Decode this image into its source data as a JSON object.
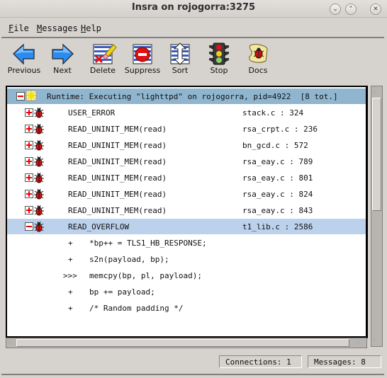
{
  "window": {
    "title": "Insra on rojogorra:3275",
    "controls": [
      "minimize",
      "maximize",
      "close"
    ]
  },
  "menubar": {
    "items": [
      {
        "label": "File",
        "mnemonic": "F",
        "rest": "ile"
      },
      {
        "label": "Messages",
        "mnemonic": "M",
        "rest": "essages"
      },
      {
        "label": "Help",
        "mnemonic": "H",
        "rest": "elp"
      }
    ]
  },
  "toolbar": {
    "buttons": [
      {
        "label": "Previous",
        "icon": "arrow-left-icon"
      },
      {
        "label": "Next",
        "icon": "arrow-right-icon"
      },
      {
        "label": "Delete",
        "icon": "delete-eraser-icon"
      },
      {
        "label": "Suppress",
        "icon": "suppress-icon"
      },
      {
        "label": "Sort",
        "icon": "sort-icon"
      },
      {
        "label": "Stop",
        "icon": "traffic-light-icon"
      },
      {
        "label": "Docs",
        "icon": "docs-scroll-icon"
      }
    ]
  },
  "tree": {
    "header": {
      "expanded": true,
      "icon": "runtime-sun-icon",
      "text": "Runtime: Executing \"lighttpd\" on rojogorra, pid=4922  [8 tot.]"
    },
    "messages": [
      {
        "expanded": false,
        "name": "USER_ERROR",
        "location": "stack.c : 324"
      },
      {
        "expanded": false,
        "name": "READ_UNINIT_MEM(read)",
        "location": "rsa_crpt.c : 236"
      },
      {
        "expanded": false,
        "name": "READ_UNINIT_MEM(read)",
        "location": "bn_gcd.c : 572"
      },
      {
        "expanded": false,
        "name": "READ_UNINIT_MEM(read)",
        "location": "rsa_eay.c : 789"
      },
      {
        "expanded": false,
        "name": "READ_UNINIT_MEM(read)",
        "location": "rsa_eay.c : 801"
      },
      {
        "expanded": false,
        "name": "READ_UNINIT_MEM(read)",
        "location": "rsa_eay.c : 824"
      },
      {
        "expanded": false,
        "name": "READ_UNINIT_MEM(read)",
        "location": "rsa_eay.c : 843"
      },
      {
        "expanded": true,
        "selected": true,
        "name": "READ_OVERFLOW",
        "location": "t1_lib.c : 2586"
      }
    ],
    "source_lines": [
      {
        "marker": "+",
        "code": "*bp++ = TLS1_HB_RESPONSE;"
      },
      {
        "marker": "+",
        "code": "s2n(payload, bp);"
      },
      {
        "marker": ">>>",
        "code": "memcpy(bp, pl, payload);"
      },
      {
        "marker": "+",
        "code": "bp += payload;"
      },
      {
        "marker": "+",
        "code": "/* Random padding */"
      }
    ]
  },
  "statusbar": {
    "connections": "Connections: 1",
    "messages": "Messages: 8"
  },
  "colors": {
    "header_row": "#8fb5cf",
    "selected_row": "#bcd2ec",
    "window_bg": "#d6d2ce"
  }
}
